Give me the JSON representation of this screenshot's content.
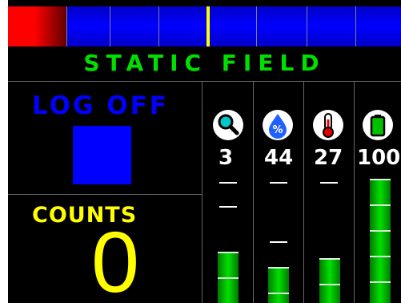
{
  "title": "STATIC FIELD",
  "log": {
    "label": "LOG OFF",
    "indicator_color": "#0000ff"
  },
  "counts": {
    "label": "COUNTS",
    "value": "0"
  },
  "colors": {
    "title": "#00e000",
    "log": "#0000ff",
    "counts": "#ffff00",
    "bar": "#00e000",
    "background": "#000000"
  },
  "top_meter": {
    "red_zone_fraction": 0.15,
    "marker_fraction": 0.51
  },
  "sensors": [
    {
      "name": "magnifier",
      "icon": "magnifier-icon",
      "value": "3",
      "level": 0.41
    },
    {
      "name": "humidity",
      "icon": "humidity-icon",
      "value": "44",
      "level": 0.29
    },
    {
      "name": "temperature",
      "icon": "thermometer-icon",
      "value": "27",
      "level": 0.36
    },
    {
      "name": "battery",
      "icon": "battery-icon",
      "value": "100",
      "level": 1.0
    }
  ]
}
